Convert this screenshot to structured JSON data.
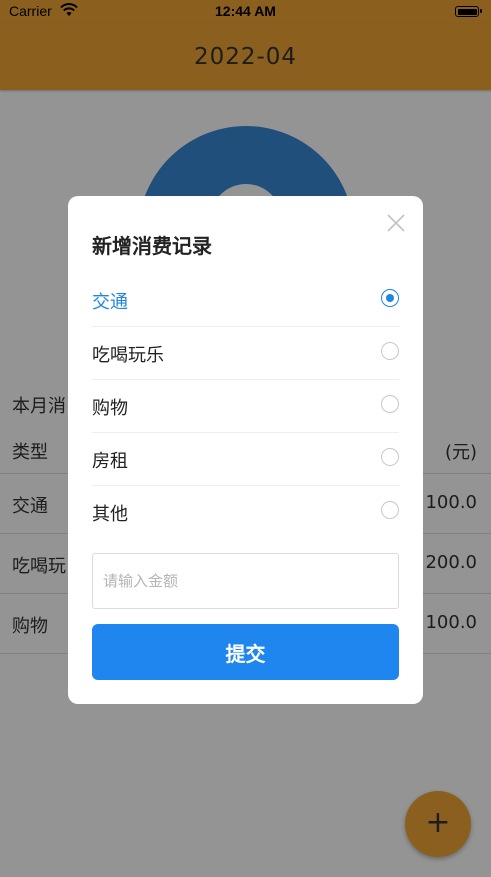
{
  "status_bar": {
    "carrier": "Carrier",
    "time": "12:44 AM"
  },
  "header": {
    "title": "2022-04"
  },
  "chart_data": {
    "type": "pie",
    "title": "",
    "note": "donut partially hidden behind dialog"
  },
  "summary": {
    "label": "本月消"
  },
  "table": {
    "headers": {
      "type": "类型",
      "amount": "(元)"
    },
    "rows": [
      {
        "type": "交通",
        "amount": "100.0"
      },
      {
        "type": "吃喝玩",
        "amount": "200.0"
      },
      {
        "type": "购物",
        "amount": "100.0"
      }
    ]
  },
  "fab": {
    "label": "+"
  },
  "dialog": {
    "title": "新增消费记录",
    "options": [
      {
        "label": "交通",
        "selected": true
      },
      {
        "label": "吃喝玩乐",
        "selected": false
      },
      {
        "label": "购物",
        "selected": false
      },
      {
        "label": "房租",
        "selected": false
      },
      {
        "label": "其他",
        "selected": false
      }
    ],
    "amount_placeholder": "请输入金额",
    "amount_value": "",
    "submit_label": "提交"
  },
  "colors": {
    "accent": "#f0a534",
    "primary": "#1f86f0",
    "chart": "#3a88d6"
  }
}
